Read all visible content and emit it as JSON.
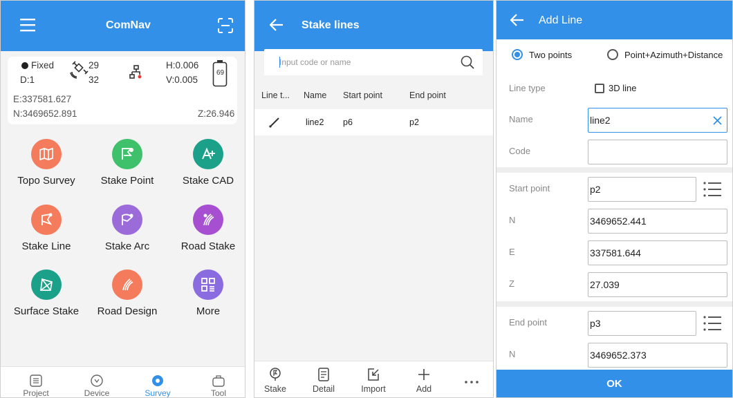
{
  "colors": {
    "primary": "#3390e8",
    "topo": "#f47c5c",
    "stake_point": "#3fc06a",
    "stake_cad": "#1ba08a",
    "stake_line": "#f47c5c",
    "stake_arc": "#9b6bd9",
    "road_stake": "#a64fd0",
    "surface_stake": "#1ba08a",
    "road_design": "#f47c5c",
    "more": "#8a6be0"
  },
  "survey_screen": {
    "title": "ComNav",
    "menu_icon": "hamburger-icon",
    "scan_icon": "scan-icon",
    "status": {
      "solution": "Fixed",
      "sat_used": "29",
      "sat_total": "32",
      "diff": "D:1",
      "h_precision": "H:0.006",
      "v_precision": "V:0.005",
      "battery": "69",
      "easting": "E:337581.627",
      "northing": "N:3469652.891",
      "elevation": "Z:26.946"
    },
    "menu_items": [
      {
        "label": "Topo Survey",
        "icon": "map-icon"
      },
      {
        "label": "Stake Point",
        "icon": "stake-point-icon"
      },
      {
        "label": "Stake CAD",
        "icon": "cad-icon"
      },
      {
        "label": "Stake Line",
        "icon": "stake-line-icon"
      },
      {
        "label": "Stake Arc",
        "icon": "stake-arc-icon"
      },
      {
        "label": "Road Stake",
        "icon": "road-icon"
      },
      {
        "label": "Surface Stake",
        "icon": "surface-icon"
      },
      {
        "label": "Road Design",
        "icon": "road-design-icon"
      },
      {
        "label": "More",
        "icon": "more-grid-icon"
      }
    ],
    "nav": [
      {
        "label": "Project",
        "active": false
      },
      {
        "label": "Device",
        "active": false
      },
      {
        "label": "Survey",
        "active": true
      },
      {
        "label": "Tool",
        "active": false
      }
    ]
  },
  "stake_lines_screen": {
    "title": "Stake lines",
    "search_placeholder": "Input code or name",
    "columns": [
      "Line t...",
      "Name",
      "Start point",
      "End point"
    ],
    "rows": [
      {
        "type_icon": "line-icon",
        "name": "line2",
        "start": "p6",
        "end": "p2"
      }
    ],
    "toolbar": [
      {
        "label": "Stake",
        "icon": "stake-icon"
      },
      {
        "label": "Detail",
        "icon": "detail-icon"
      },
      {
        "label": "Import",
        "icon": "import-icon"
      },
      {
        "label": "Add",
        "icon": "plus-icon"
      }
    ],
    "more_icon": "ellipsis-icon"
  },
  "add_line_screen": {
    "title": "Add Line",
    "mode_options": [
      "Two points",
      "Point+Azimuth+Distance"
    ],
    "selected_mode": "Two points",
    "line_type_label": "Line type",
    "line_type_option": "3D line",
    "line_type_checked": false,
    "name_label": "Name",
    "name_value": "line2",
    "code_label": "Code",
    "code_value": "",
    "start_point_label": "Start point",
    "start_point_value": "p2",
    "start_n_label": "N",
    "start_n_value": "3469652.441",
    "start_e_label": "E",
    "start_e_value": "337581.644",
    "start_z_label": "Z",
    "start_z_value": "27.039",
    "end_point_label": "End point",
    "end_point_value": "p3",
    "end_n_label": "N",
    "end_n_value": "3469652.373",
    "ok_label": "OK"
  }
}
